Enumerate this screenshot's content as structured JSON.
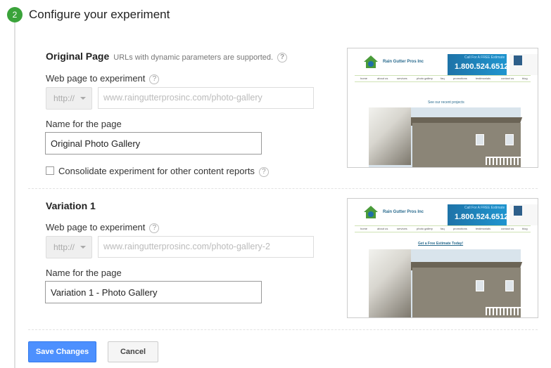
{
  "step": {
    "number": "2",
    "title": "Configure your experiment"
  },
  "help_glyph": "?",
  "original": {
    "title": "Original Page",
    "hint": "URLs with dynamic parameters are supported.",
    "web_label": "Web page to experiment",
    "protocol": "http://",
    "url": "www.raingutterprosinc.com/photo-gallery",
    "name_label": "Name for the page",
    "name_value": "Original Photo Gallery",
    "consolidate_label": "Consolidate experiment for other content reports",
    "consolidate_checked": false
  },
  "variation": {
    "title": "Variation 1",
    "web_label": "Web page to experiment",
    "protocol": "http://",
    "url": "www.raingutterprosinc.com/photo-gallery-2",
    "name_label": "Name for the page",
    "name_value": "Variation 1 - Photo Gallery"
  },
  "preview_original": {
    "brand": "Rain Gutter Pros Inc",
    "cta": "Call For A FREE Estimate",
    "phone": "1.800.524.6512",
    "nav": [
      "home",
      "about us",
      "services",
      "photo gallery",
      "faq",
      "promotions",
      "testimonials",
      "contact us",
      "blog"
    ],
    "subheading": "See our recent projects"
  },
  "preview_variation": {
    "brand": "Rain Gutter Pros Inc",
    "cta": "Call For A FREE Estimate",
    "phone": "1.800.524.6512",
    "nav": [
      "home",
      "about us",
      "services",
      "photo gallery",
      "faq",
      "promotions",
      "testimonials",
      "contact us",
      "blog"
    ],
    "subheading": "Get a Free Estimate Today!"
  },
  "buttons": {
    "save": "Save Changes",
    "cancel": "Cancel"
  },
  "colors": {
    "step_badge": "#3aa33a",
    "primary": "#4d90fe",
    "phone_band": "#1f95cf"
  }
}
